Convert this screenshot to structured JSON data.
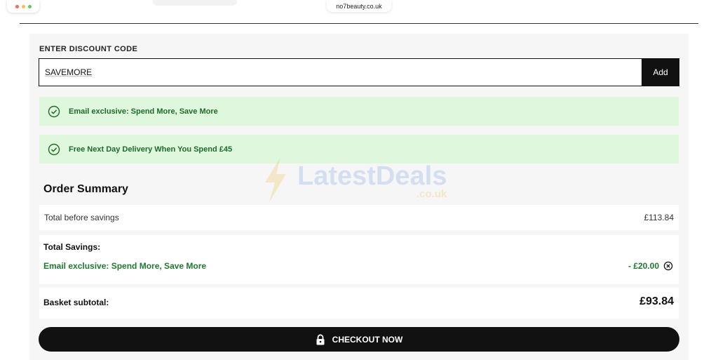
{
  "browser": {
    "url": "no7beauty.co.uk",
    "dots": [
      "#f26a5a",
      "#f4bf4f",
      "#5dc766"
    ]
  },
  "discount": {
    "label": "ENTER DISCOUNT CODE",
    "code_value": "SAVEMORE",
    "add_label": "Add"
  },
  "notices": [
    {
      "text": "Email exclusive: Spend More, Save More"
    },
    {
      "text": "Free Next Day Delivery When You Spend £45"
    }
  ],
  "watermark": {
    "main": "LatestDeals",
    "sub": ".co.uk"
  },
  "order_summary": {
    "title": "Order Summary",
    "total_before_label": "Total before savings",
    "total_before_value": "£113.84",
    "savings_label": "Total Savings:",
    "savings_item_label": "Email exclusive: Spend More, Save More",
    "savings_item_value": "- £20.00",
    "subtotal_label": "Basket subtotal:",
    "subtotal_value": "£93.84"
  },
  "checkout": {
    "label": "CHECKOUT NOW"
  },
  "colors": {
    "success_green": "#1d7a2e",
    "notice_bg": "#dff7dc",
    "button_dark": "#111111"
  }
}
